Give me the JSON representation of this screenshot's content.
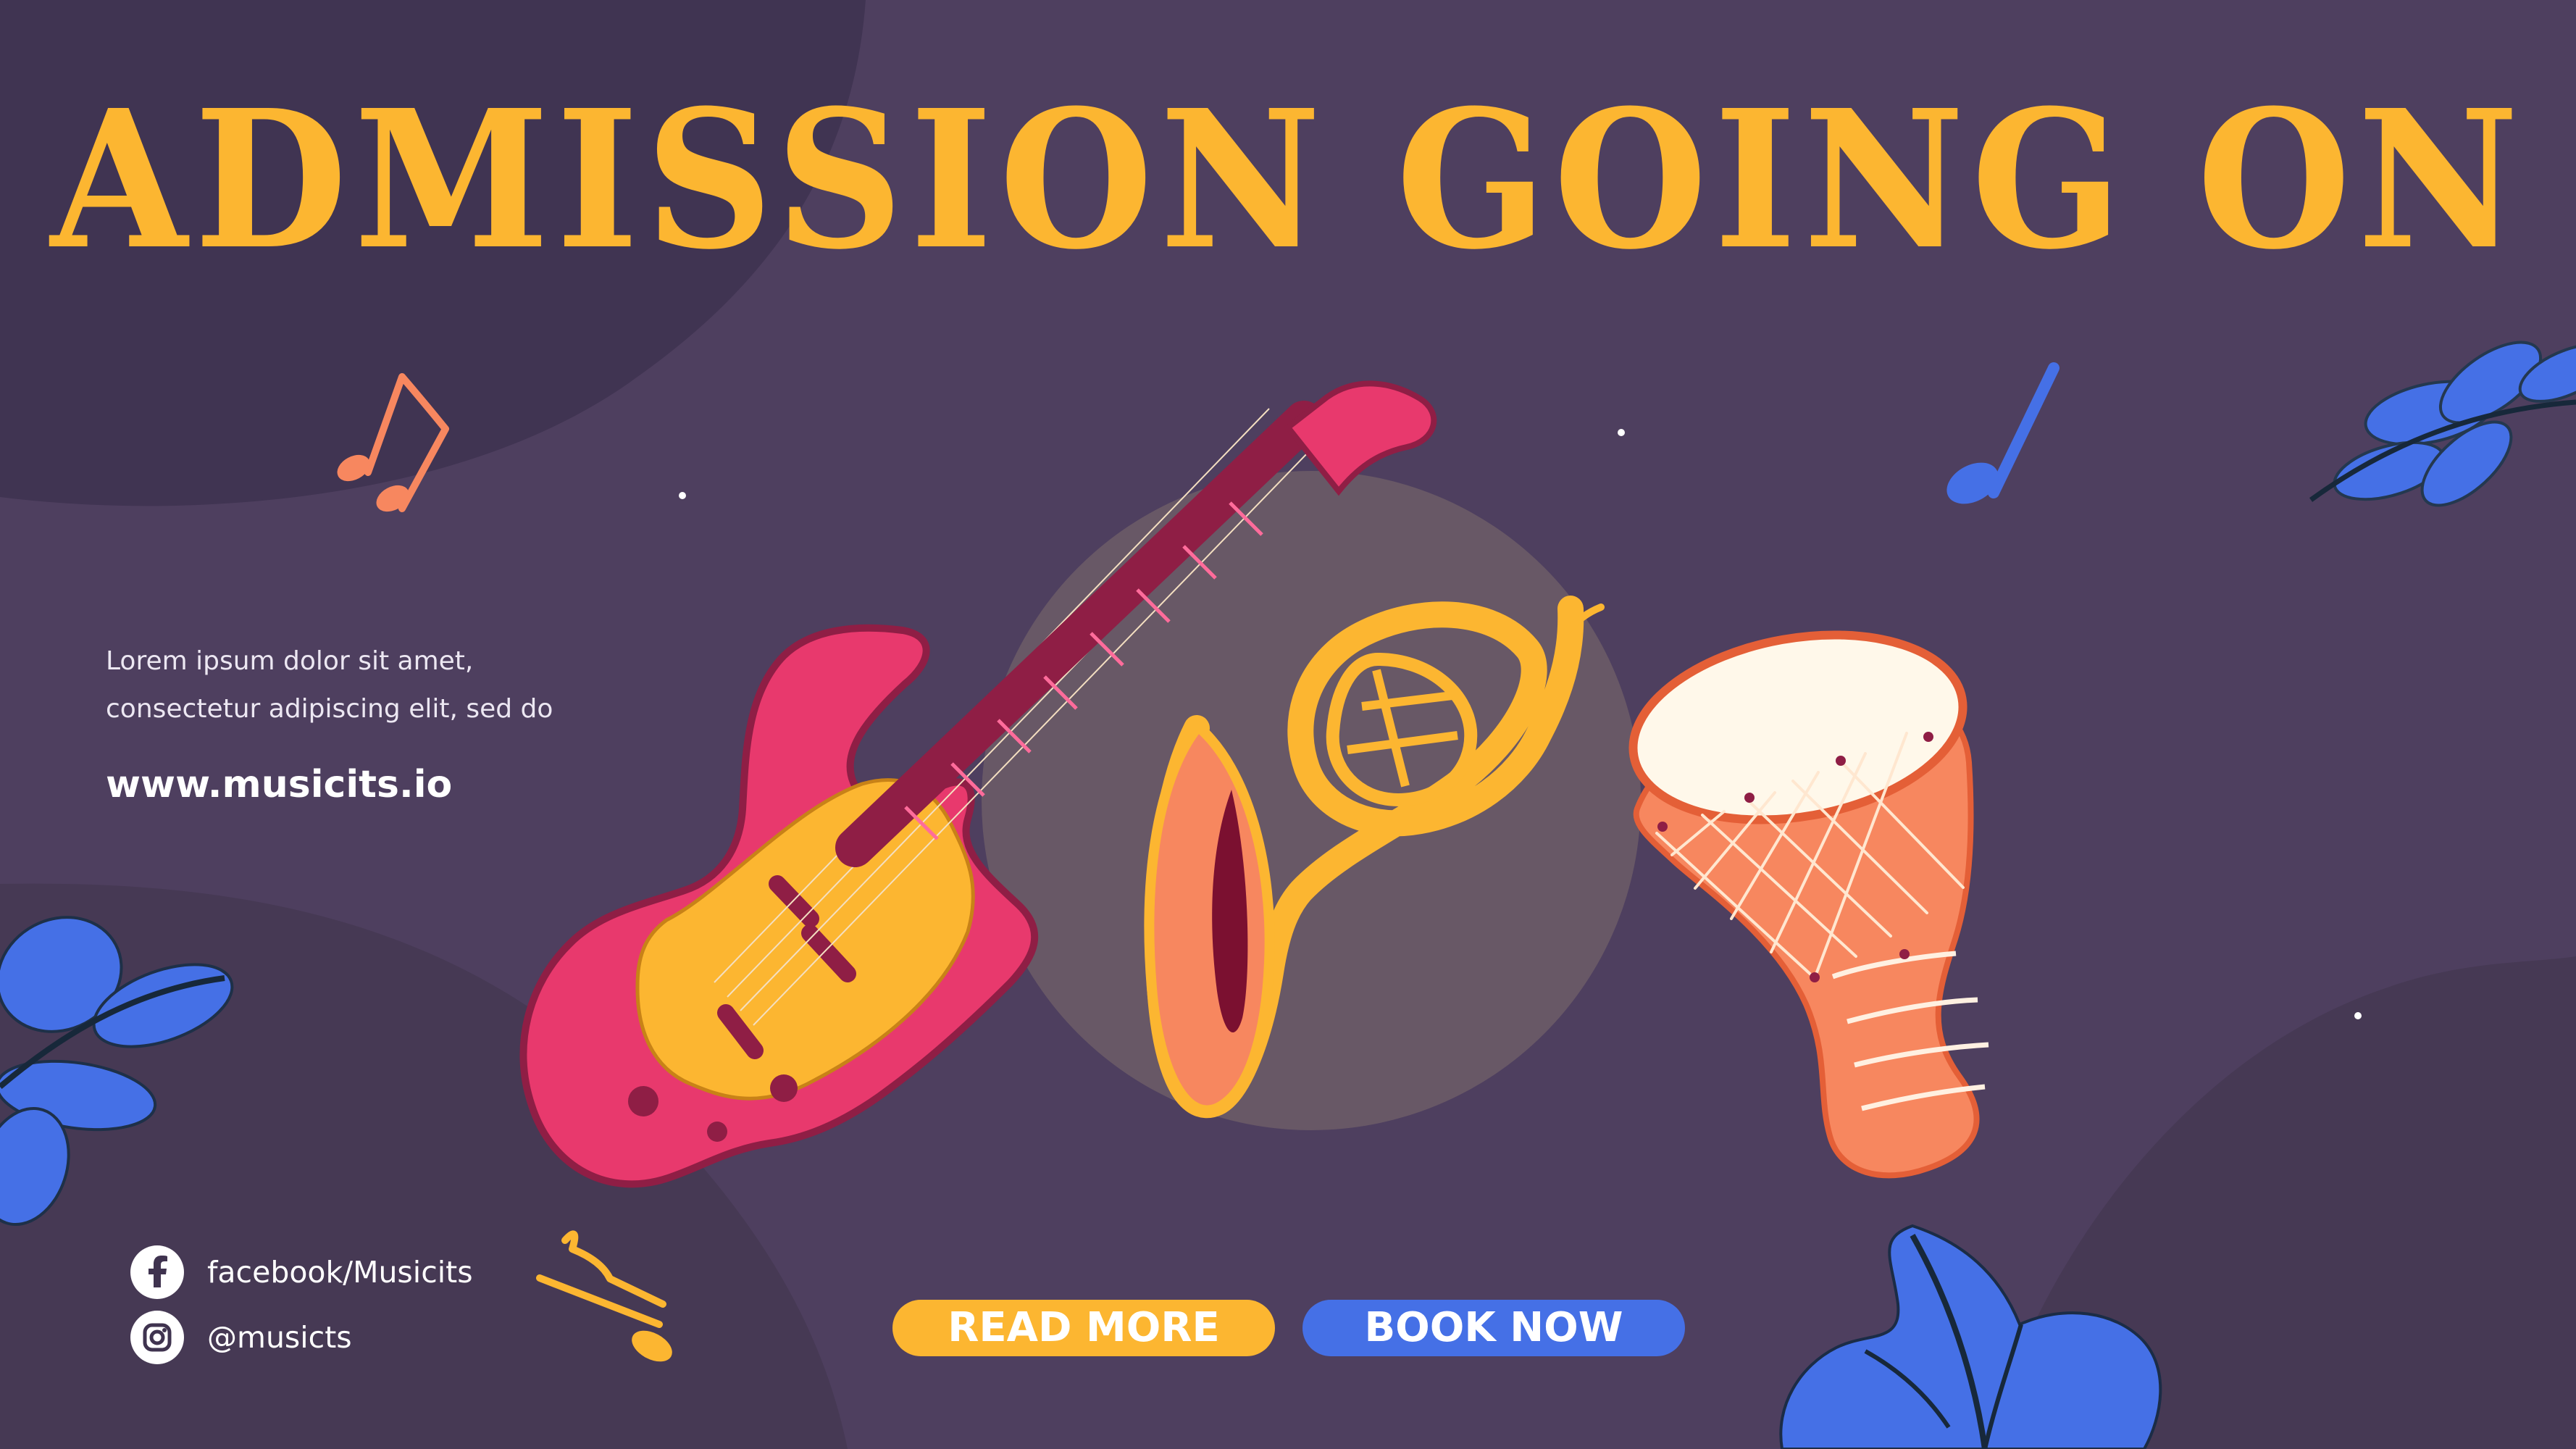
{
  "banner": {
    "headline": "ADMISSION GOING ON",
    "intro_line_1": "Lorem ipsum dolor sit amet,",
    "intro_line_2": "consectetur  adipiscing elit, sed do",
    "website": "www.musicits.io"
  },
  "social": {
    "facebook": {
      "icon": "facebook-icon",
      "label": "facebook/Musicits"
    },
    "instagram": {
      "icon": "instagram-icon",
      "label": "@musicts"
    }
  },
  "actions": {
    "read_more": "READ MORE",
    "book_now": "BOOK NOW"
  },
  "colors": {
    "background": "#4e3f5f",
    "headline": "#fcb631",
    "read_more": "#fcb631",
    "book_now": "#4570e6",
    "leaf": "#4570e6",
    "guitar": "#e8396d",
    "horn": "#fcb631",
    "drum": "#f7875f"
  },
  "illustrations": [
    "electric-guitar-icon",
    "french-horn-icon",
    "djembe-drum-icon",
    "music-note-icon",
    "leaf-icon"
  ]
}
